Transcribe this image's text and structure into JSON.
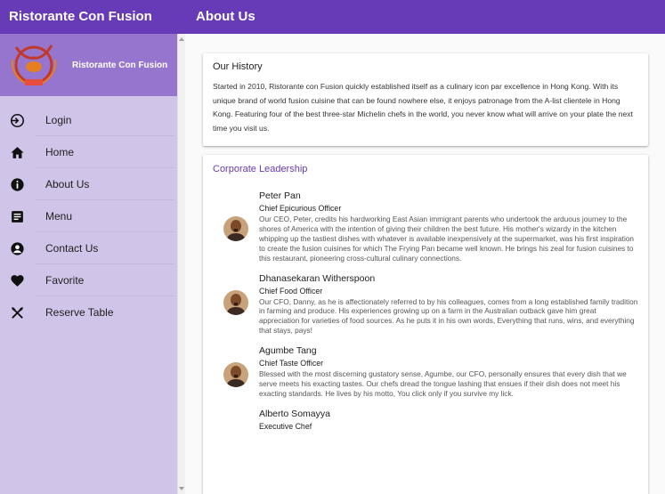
{
  "sidebar": {
    "title": "Ristorante Con Fusion",
    "drawer_title": "Ristorante Con Fusion",
    "items": [
      {
        "label": "Login",
        "icon": "login-icon"
      },
      {
        "label": "Home",
        "icon": "home-icon"
      },
      {
        "label": "About Us",
        "icon": "info-icon"
      },
      {
        "label": "Menu",
        "icon": "menu-list-icon"
      },
      {
        "label": "Contact Us",
        "icon": "contact-icon"
      },
      {
        "label": "Favorite",
        "icon": "heart-icon"
      },
      {
        "label": "Reserve Table",
        "icon": "cutlery-icon"
      }
    ]
  },
  "header": {
    "title": "About Us"
  },
  "history": {
    "title": "Our History",
    "text": "Started in 2010, Ristorante con Fusion quickly established itself as a culinary icon par excellence in Hong Kong. With its unique brand of world fusion cuisine that can be found nowhere else, it enjoys patronage from the A-list clientele in Hong Kong. Featuring four of the best three-star Michelin chefs in the world, you never know what will arrive on your plate the next time you visit us."
  },
  "leadership": {
    "title": "Corporate Leadership",
    "leaders": [
      {
        "name": "Peter Pan",
        "role": "Chief Epicurious Officer",
        "bio": "Our CEO, Peter, credits his hardworking East Asian immigrant parents who undertook the arduous journey to the shores of America with the intention of giving their children the best future. His mother's wizardy in the kitchen whipping up the tastiest dishes with whatever is available inexpensively at the supermarket, was his first inspiration to create the fusion cuisines for which The Frying Pan became well known. He brings his zeal for fusion cuisines to this restaurant, pioneering cross-cultural culinary connections."
      },
      {
        "name": "Dhanasekaran Witherspoon",
        "role": "Chief Food Officer",
        "bio": "Our CFO, Danny, as he is affectionately referred to by his colleagues, comes from a long established family tradition in farming and produce. His experiences growing up on a farm in the Australian outback gave him great appreciation for varieties of food sources. As he puts it in his own words, Everything that runs, wins, and everything that stays, pays!"
      },
      {
        "name": "Agumbe Tang",
        "role": "Chief Taste Officer",
        "bio": "Blessed with the most discerning gustatory sense, Agumbe, our CFO, personally ensures that every dish that we serve meets his exacting tastes. Our chefs dread the tongue lashing that ensues if their dish does not meet his exacting standards. He lives by his motto, You click only if you survive my lick."
      },
      {
        "name": "Alberto Somayya",
        "role": "Executive Chef",
        "bio": ""
      }
    ]
  },
  "colors": {
    "primary": "#673ab7",
    "drawer_bg": "#d1c4e9",
    "drawer_banner": "#9575cd"
  }
}
